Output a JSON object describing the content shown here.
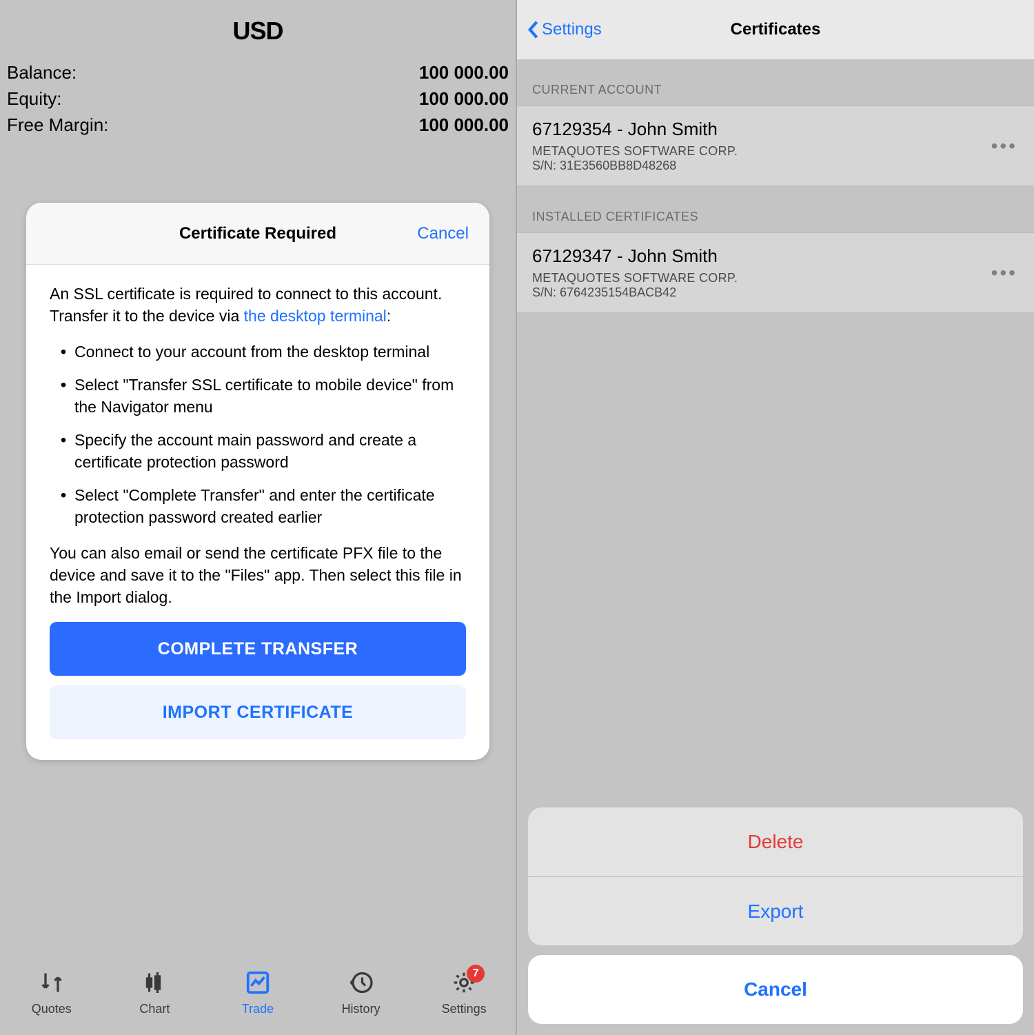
{
  "left": {
    "currency": "USD",
    "rows": [
      {
        "label": "Balance:",
        "value": "100 000.00"
      },
      {
        "label": "Equity:",
        "value": "100 000.00"
      },
      {
        "label": "Free Margin:",
        "value": "100 000.00"
      }
    ],
    "modal": {
      "title": "Certificate Required",
      "cancel": "Cancel",
      "intro_pre": "An SSL certificate is required to connect to this account. Transfer it to the device via ",
      "intro_link": "the desktop terminal",
      "intro_post": ":",
      "steps": [
        "Connect to your account from the desktop terminal",
        "Select \"Transfer SSL certificate to mobile device\" from the Navigator menu",
        "Specify the account main password and create a certificate protection password",
        "Select \"Complete Transfer\" and enter the certificate protection password created earlier"
      ],
      "outro": "You can also email or send the certificate PFX file to the device and save it to the \"Files\" app. Then select this file in the Import dialog.",
      "btn_primary": "COMPLETE TRANSFER",
      "btn_secondary": "IMPORT CERTIFICATE"
    },
    "tabs": {
      "quotes": "Quotes",
      "chart": "Chart",
      "trade": "Trade",
      "history": "History",
      "settings": "Settings",
      "settings_badge": "7"
    }
  },
  "right": {
    "back": "Settings",
    "title": "Certificates",
    "section_current": "CURRENT ACCOUNT",
    "section_installed": "INSTALLED CERTIFICATES",
    "cert1": {
      "title": "67129354 - John Smith",
      "company": "METAQUOTES SOFTWARE CORP.",
      "sn": "S/N: 31E3560BB8D48268"
    },
    "cert2": {
      "title": "67129347 - John Smith",
      "company": "METAQUOTES SOFTWARE CORP.",
      "sn": "S/N: 6764235154BACB42"
    },
    "sheet": {
      "delete": "Delete",
      "export": "Export",
      "cancel": "Cancel"
    }
  }
}
